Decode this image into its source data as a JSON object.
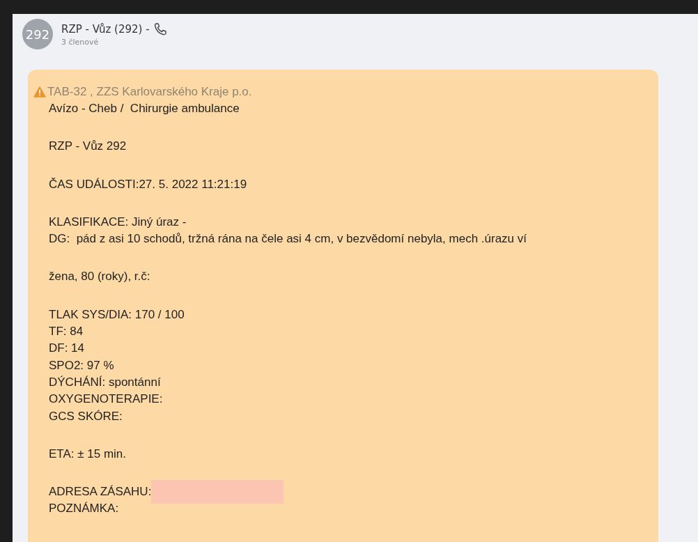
{
  "chat_header": {
    "avatar": "292",
    "title": "RZP - Vůz (292) -",
    "members": "3 členové"
  },
  "message": {
    "sender": "TAB-32 , ZZS Karlovarského Kraje p.o.",
    "important": true,
    "blocks": [
      [
        {
          "text": "Avízo - Cheb /  Chirurgie ambulance"
        }
      ],
      [
        {
          "text": "RZP - Vůz 292"
        }
      ],
      [
        {
          "text": "ČAS UDÁLOSTI:27. 5. 2022 11:21:19"
        }
      ],
      [
        {
          "text": "KLASIFIKACE: Jiný úraz -"
        },
        {
          "text": "DG:  pád z asi 10 schodů, tržná rána na čele asi 4 cm, v bezvědomí nebyla, mech .úrazu ví"
        }
      ],
      [
        {
          "text": "žena, 80 (roky), r.č:"
        }
      ],
      [
        {
          "text": "TLAK SYS/DIA: 170 / 100"
        },
        {
          "text": "TF: 84"
        },
        {
          "text": "DF: 14"
        },
        {
          "text": "SPO2: 97 %"
        },
        {
          "text": "DÝCHÁNÍ: spontánní"
        },
        {
          "text": "OXYGENOTERAPIE:"
        },
        {
          "text": "GCS SKÓRE:"
        }
      ],
      [
        {
          "text": "ETA: ± 15 min."
        }
      ],
      [
        {
          "text": "ADRESA ZÁSAHU:",
          "redacted": true
        },
        {
          "text": "POZNÁMKA:"
        }
      ]
    ]
  }
}
